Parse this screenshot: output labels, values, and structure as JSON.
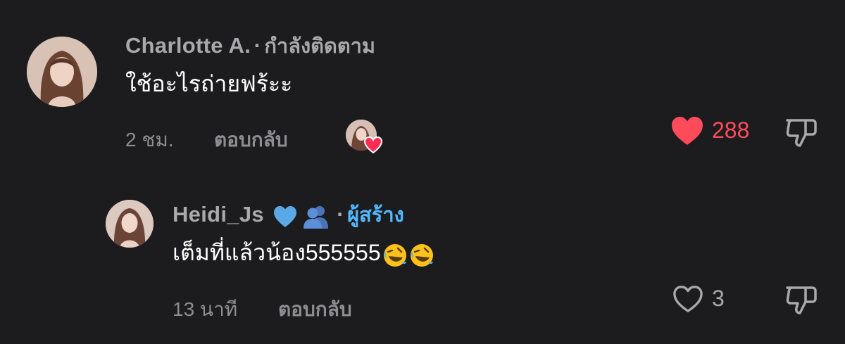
{
  "comments": [
    {
      "username": "Charlotte A.",
      "separator": "·",
      "status_label": "กำลังติดตาม",
      "text": "ใช้อะไรถ่ายฟร้ะะ",
      "time": "2 ชม.",
      "reply_label": "ตอบกลับ",
      "like_count": "288",
      "liked": true,
      "creator_liked": true
    },
    {
      "username": "Heidi_Js",
      "name_emojis": [
        "blue-heart-icon",
        "busts-in-silhouette-icon"
      ],
      "separator": "·",
      "status_label": "ผู้สร้าง",
      "text": "เต็มที่แล้วน้อง555555",
      "text_emojis": [
        "rolling-on-floor-laughing-icon",
        "rolling-on-floor-laughing-icon"
      ],
      "time": "13 นาที",
      "reply_label": "ตอบกลับ",
      "like_count": "3",
      "liked": false
    }
  ],
  "colors": {
    "background": "#1c1c1e",
    "liked_heart": "#fe4b5c",
    "creator_label": "#53b8ff",
    "muted_text": "#a9a9ad"
  }
}
